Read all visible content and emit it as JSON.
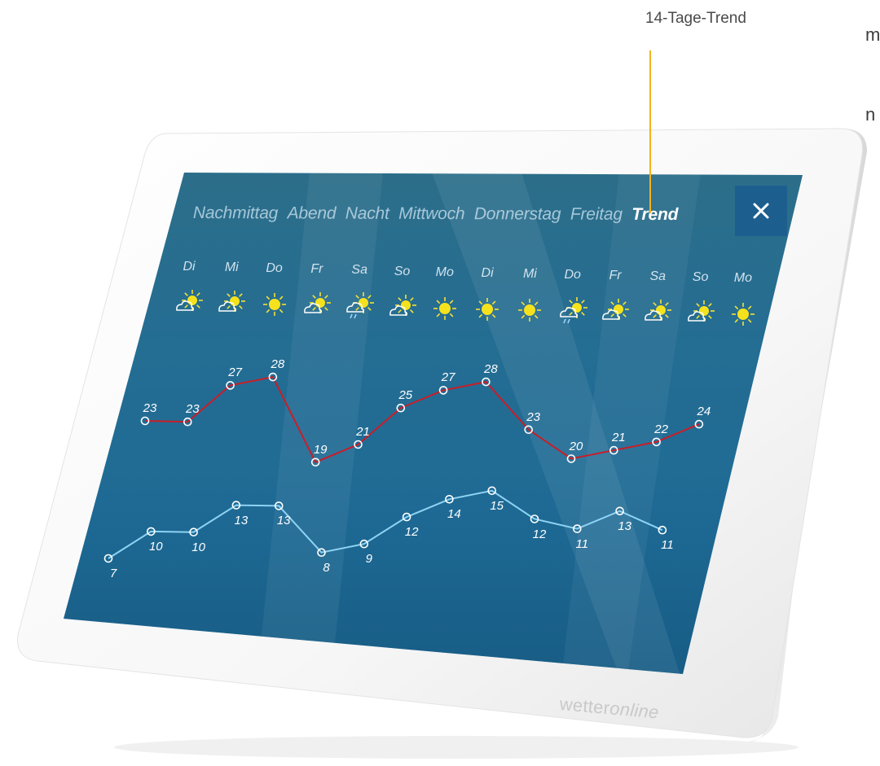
{
  "edge_text": [
    "m",
    "n"
  ],
  "callout": {
    "label": "14-Tage-Trend"
  },
  "tabs": [
    {
      "label": "Nachmittag",
      "active": false
    },
    {
      "label": "Abend",
      "active": false
    },
    {
      "label": "Nacht",
      "active": false
    },
    {
      "label": "Mittwoch",
      "active": false
    },
    {
      "label": "Donnerstag",
      "active": false
    },
    {
      "label": "Freitag",
      "active": false
    },
    {
      "label": "Trend",
      "active": true
    }
  ],
  "close_icon": "close-icon",
  "days": [
    {
      "label": "Di",
      "icon": "partly-cloudy-icon"
    },
    {
      "label": "Mi",
      "icon": "partly-cloudy-icon"
    },
    {
      "label": "Do",
      "icon": "sun-icon"
    },
    {
      "label": "Fr",
      "icon": "partly-cloudy-icon"
    },
    {
      "label": "Sa",
      "icon": "shower-sun-icon"
    },
    {
      "label": "So",
      "icon": "partly-cloudy-icon"
    },
    {
      "label": "Mo",
      "icon": "sun-icon"
    },
    {
      "label": "Di",
      "icon": "sun-icon"
    },
    {
      "label": "Mi",
      "icon": "sun-icon"
    },
    {
      "label": "Do",
      "icon": "shower-sun-icon"
    },
    {
      "label": "Fr",
      "icon": "partly-cloudy-icon"
    },
    {
      "label": "Sa",
      "icon": "partly-cloudy-icon"
    },
    {
      "label": "So",
      "icon": "partly-cloudy-icon"
    },
    {
      "label": "Mo",
      "icon": "sun-icon"
    }
  ],
  "chart_data": {
    "type": "line",
    "categories": [
      "Di",
      "Mi",
      "Do",
      "Fr",
      "Sa",
      "So",
      "Mo",
      "Di",
      "Mi",
      "Do",
      "Fr",
      "Sa",
      "So",
      "Mo"
    ],
    "series": [
      {
        "values": [
          23,
          23,
          27,
          28,
          19,
          21,
          25,
          27,
          28,
          23,
          20,
          21,
          22,
          24
        ]
      },
      {
        "values": [
          7,
          10,
          10,
          13,
          13,
          8,
          9,
          12,
          14,
          15,
          12,
          11,
          13,
          11
        ]
      }
    ],
    "colors": {
      "max": "#c81e28",
      "min": "#8fd3f4"
    }
  },
  "brand": {
    "prefix": "wetter",
    "suffix": "online"
  }
}
